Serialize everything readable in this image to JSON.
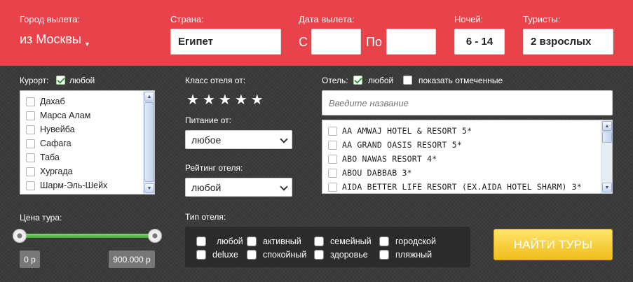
{
  "top": {
    "departure_city_label": "Город вылета:",
    "departure_city_value": "из Москвы",
    "country_label": "Страна:",
    "country_value": "Египет",
    "date_label": "Дата вылета:",
    "date_from_label": "С",
    "date_to_label": "По",
    "date_from_value": "",
    "date_to_value": "",
    "nights_label": "Ночей:",
    "nights_value": "6 - 14",
    "tourists_label": "Туристы:",
    "tourists_value": "2 взрослых"
  },
  "resort": {
    "label": "Курорт:",
    "any_label": "любой",
    "items": [
      "Дахаб",
      "Марса Алам",
      "Нувейба",
      "Сафага",
      "Таба",
      "Хургада",
      "Шарм-Эль-Шейх"
    ]
  },
  "hotel_class": {
    "label": "Класс отеля от:",
    "stars": 5
  },
  "meal": {
    "label": "Питание от:",
    "value": "любое"
  },
  "rating": {
    "label": "Рейтинг отеля:",
    "value": "любой"
  },
  "hotel": {
    "label": "Отель:",
    "any_label": "любой",
    "show_marked_label": "показать отмеченные",
    "search_placeholder": "Введите название",
    "items": [
      "AA AMWAJ HOTEL & RESORT 5*",
      "AA GRAND OASIS RESORT 5*",
      "ABO NAWAS RESORT 4*",
      "ABOU DABBAB 3*",
      "AIDA BETTER LIFE RESORT (EX.AIDA HOTEL SHARM) 3*"
    ]
  },
  "price": {
    "label": "Цена тура:",
    "min": "0 р",
    "max": "900.000 р"
  },
  "hotel_type": {
    "label": "Тип отеля:",
    "options": [
      "любой",
      "активный",
      "семейный",
      "городской",
      "deluxe",
      "спокойный",
      "здоровье",
      "пляжный"
    ]
  },
  "search_button": "НАЙТИ ТУРЫ"
}
